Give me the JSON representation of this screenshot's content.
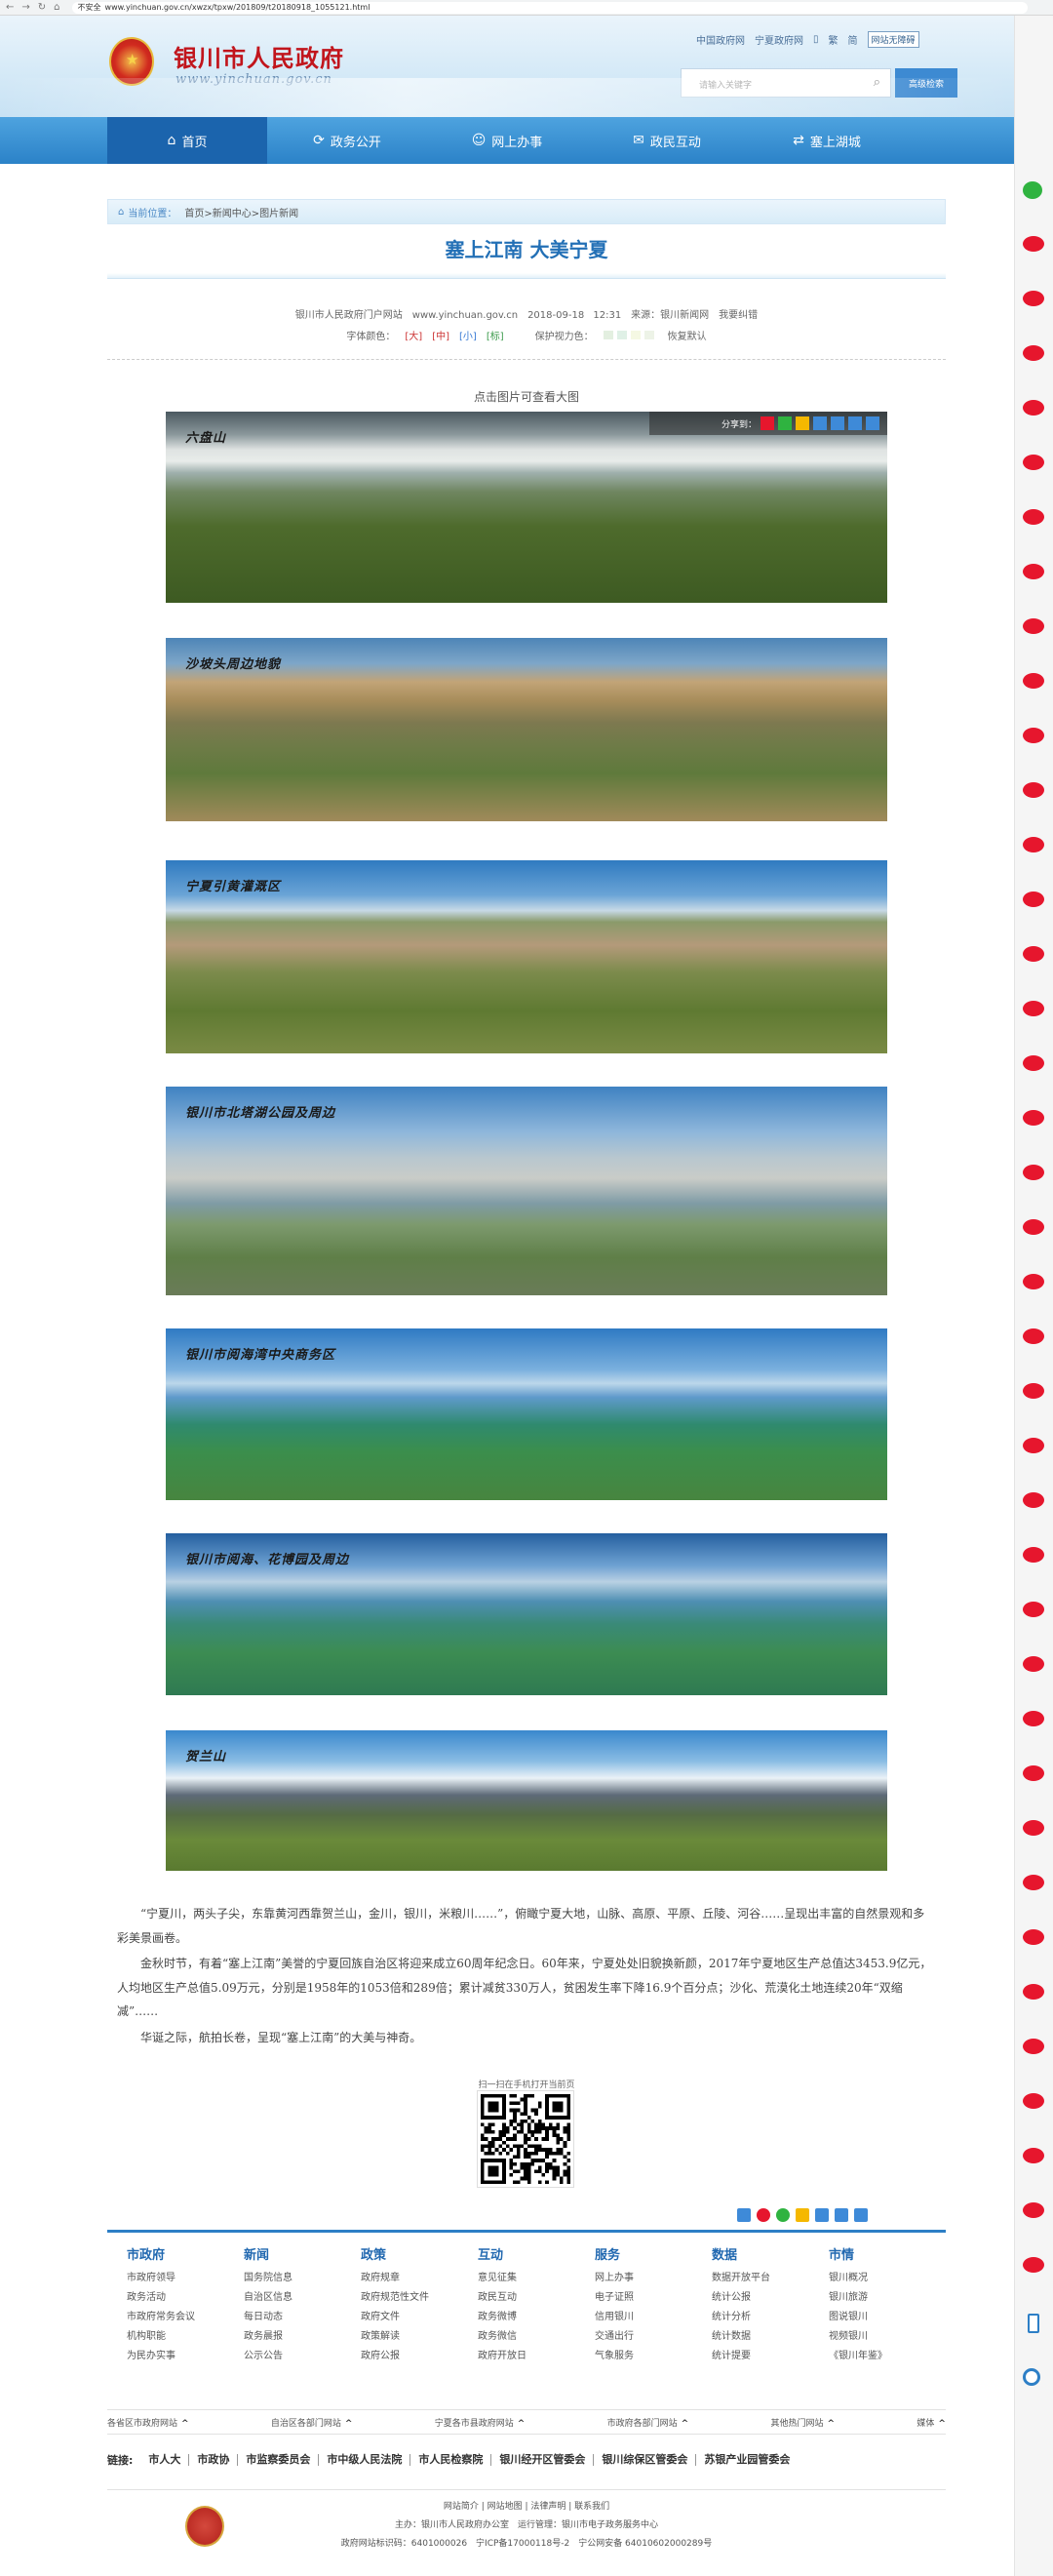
{
  "browser": {
    "security": "不安全",
    "url": "www.yinchuan.gov.cn/xwzx/tpxw/201809/t20180918_1055121.html"
  },
  "header": {
    "site_title": "银川市人民政府",
    "site_domain": "www.yinchuan.gov.cn",
    "top_links": [
      "中国政府网",
      "宁夏政府网",
      "繁",
      "简",
      "网站无障碍"
    ],
    "search_placeholder": "请输入关键字",
    "advanced_search": "高级检索"
  },
  "nav": {
    "items": [
      {
        "label": "首页",
        "icon": "home-icon"
      },
      {
        "label": "政务公开",
        "icon": "refresh-icon"
      },
      {
        "label": "网上办事",
        "icon": "user-icon"
      },
      {
        "label": "政民互动",
        "icon": "chat-icon"
      },
      {
        "label": "塞上湖城",
        "icon": "exchange-icon"
      }
    ]
  },
  "breadcrumb": {
    "label": "当前位置：",
    "path": "首页>新闻中心>图片新闻"
  },
  "article": {
    "title": "塞上江南 大美宁夏",
    "meta": "银川市人民政府门户网站　www.yinchuan.gov.cn　2018-09-18 12:31　来源：银川新闻网　我要纠错",
    "font_color_label": "字体颜色：",
    "font_sizes": [
      "[大]",
      "[中]",
      "[小]",
      "[标]"
    ],
    "eye_label": "保护视力色：",
    "eye_colors": [
      "#e3efe0",
      "#dff0e6",
      "#f5f8e3",
      "#edf3e7"
    ],
    "default_label": "恢复默认",
    "click_tip": "点击图片可查看大图",
    "share_label": "分享到：",
    "photos": [
      {
        "caption": "六盘山",
        "sky": "#6f7f87",
        "ground": "#4d6c2d"
      },
      {
        "caption": "沙坡头周边地貌",
        "sky": "#4e87b8",
        "ground": "#8a8a55"
      },
      {
        "caption": "宁夏引黄灌溉区",
        "sky": "#3f86c9",
        "ground": "#6f8a3e"
      },
      {
        "caption": "银川市北塔湖公园及周边",
        "sky": "#4d8bc8",
        "ground": "#6c8a58"
      },
      {
        "caption": "银川市阅海湾中央商务区",
        "sky": "#3e84c6",
        "ground": "#3c8a4a"
      },
      {
        "caption": "银川市阅海、花博园及周边",
        "sky": "#3a77b7",
        "ground": "#3f8a7e"
      },
      {
        "caption": "贺兰山",
        "sky": "#3d88cb",
        "ground": "#5d7a35"
      }
    ],
    "paragraphs": [
      "“宁夏川，两头子尖，东靠黄河西靠贺兰山，金川，银川，米粮川……”，俯瞰宁夏大地，山脉、高原、平原、丘陵、河谷……呈现出丰富的自然景观和多彩美景画卷。",
      "金秋时节，有着“塞上江南”美誉的宁夏回族自治区将迎来成立60周年纪念日。60年来，宁夏处处旧貌换新颜，2017年宁夏地区生产总值达3453.9亿元，人均地区生产总值5.09万元，分别是1958年的1053倍和289倍；累计减贫330万人，贫困发生率下降16.9个百分点；沙化、荒漠化土地连续20年“双缩减”……",
      "华诞之际，航拍长卷，呈现“塞上江南”的大美与神奇。"
    ],
    "qr_label": "扫一扫在手机打开当前页"
  },
  "footer": {
    "columns": [
      {
        "title": "市政府",
        "items": [
          "市政府领导",
          "政务活动",
          "市政府常务会议",
          "机构职能",
          "为民办实事"
        ]
      },
      {
        "title": "新闻",
        "items": [
          "国务院信息",
          "自治区信息",
          "每日动态",
          "政务晨报",
          "公示公告"
        ]
      },
      {
        "title": "政策",
        "items": [
          "政府规章",
          "政府规范性文件",
          "政府文件",
          "政策解读",
          "政府公报"
        ]
      },
      {
        "title": "互动",
        "items": [
          "意见征集",
          "政民互动",
          "政务微博",
          "政务微信",
          "政府开放日"
        ]
      },
      {
        "title": "服务",
        "items": [
          "网上办事",
          "电子证照",
          "信用银川",
          "交通出行",
          "气象服务"
        ]
      },
      {
        "title": "数据",
        "items": [
          "数据开放平台",
          "统计公报",
          "统计分析",
          "统计数据",
          "统计提要"
        ]
      },
      {
        "title": "市情",
        "items": [
          "银川概况",
          "银川旅游",
          "图说银川",
          "视频银川",
          "《银川年鉴》"
        ]
      }
    ],
    "dropdowns": [
      "各省区市政府网站",
      "自治区各部门网站",
      "宁夏各市县政府网站",
      "市政府各部门网站",
      "其他热门网站",
      "媒体"
    ],
    "links_label": "链接:",
    "links": [
      "市人大",
      "市政协",
      "市监察委员会",
      "市中级人民法院",
      "市人民检察院",
      "银川经开区管委会",
      "银川综保区管委会",
      "苏银产业园管委会"
    ],
    "bottom_nav": "网站简介 | 网站地图 | 法律声明 | 联系我们",
    "host": "主办：银川市人民政府办公室　运行管理：银川市电子政务服务中心",
    "record": "政府网站标识码：6401000026　宁ICP备17000118号-2　宁公网安备 64010602000289号",
    "emblem_text": "党政机关"
  },
  "colors": {
    "nav_blue": "#2b82c8",
    "title_red": "#c1151c",
    "article_title": "#2370b6"
  }
}
